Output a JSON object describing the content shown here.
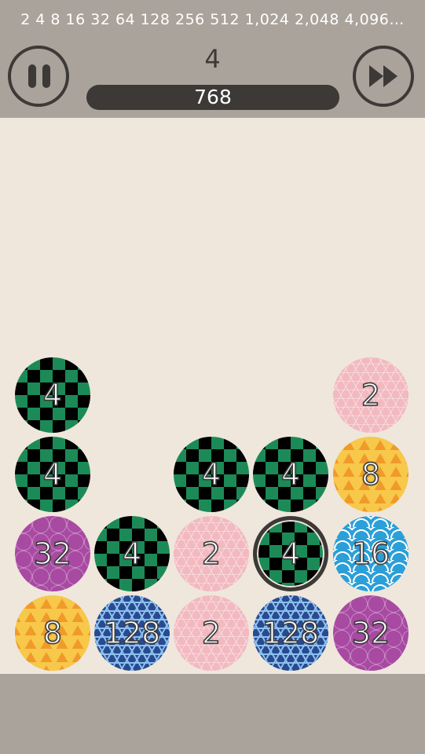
{
  "header": {
    "sequence": "2 4 8 16 32 64 128 256 512 1,024 2,048 4,096…",
    "next_value": "4",
    "score": "768"
  },
  "colors": {
    "header_bg": "#a9a39b",
    "board_bg": "#efe7dc",
    "dark": "#3d3936"
  },
  "icons": [
    "pause-icon",
    "fast-forward-icon"
  ],
  "board": {
    "balls": [
      {
        "value": "4",
        "col": 0,
        "row": 0,
        "style": "c4",
        "selected": false
      },
      {
        "value": "2",
        "col": 4,
        "row": 0,
        "style": "c2",
        "selected": false
      },
      {
        "value": "4",
        "col": 0,
        "row": 1,
        "style": "c4",
        "selected": false
      },
      {
        "value": "4",
        "col": 2,
        "row": 1,
        "style": "c4",
        "selected": false
      },
      {
        "value": "4",
        "col": 3,
        "row": 1,
        "style": "c4",
        "selected": false
      },
      {
        "value": "8",
        "col": 4,
        "row": 1,
        "style": "c8",
        "selected": false
      },
      {
        "value": "32",
        "col": 0,
        "row": 2,
        "style": "c32",
        "selected": false
      },
      {
        "value": "4",
        "col": 1,
        "row": 2,
        "style": "c4",
        "selected": false
      },
      {
        "value": "2",
        "col": 2,
        "row": 2,
        "style": "c2",
        "selected": false
      },
      {
        "value": "4",
        "col": 3,
        "row": 2,
        "style": "c4",
        "selected": true
      },
      {
        "value": "16",
        "col": 4,
        "row": 2,
        "style": "c16",
        "selected": false
      },
      {
        "value": "8",
        "col": 0,
        "row": 3,
        "style": "c8",
        "selected": false
      },
      {
        "value": "128",
        "col": 1,
        "row": 3,
        "style": "c128",
        "selected": false
      },
      {
        "value": "2",
        "col": 2,
        "row": 3,
        "style": "c2",
        "selected": false
      },
      {
        "value": "128",
        "col": 3,
        "row": 3,
        "style": "c128",
        "selected": false
      },
      {
        "value": "32",
        "col": 4,
        "row": 3,
        "style": "c32",
        "selected": false
      }
    ]
  }
}
